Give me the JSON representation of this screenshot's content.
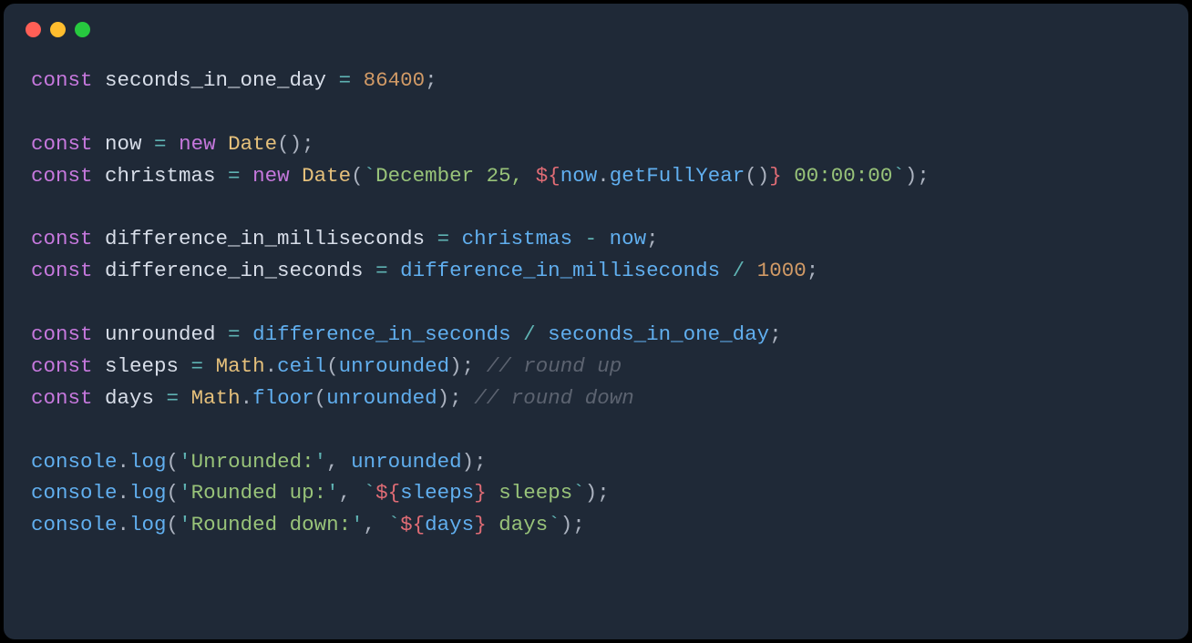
{
  "titlebar": {
    "close_color": "#ff5f56",
    "minimize_color": "#ffbd2e",
    "maximize_color": "#27c93f"
  },
  "code": {
    "l01": {
      "kw1": "const",
      "var": " seconds_in_one_day ",
      "eq": "=",
      "sp": " ",
      "num": "86400",
      "semi": ";"
    },
    "l03": {
      "kw1": "const",
      "var": " now ",
      "eq": "=",
      "sp": " ",
      "kw2": "new",
      "sp2": " ",
      "cls": "Date",
      "paren": "();"
    },
    "l04": {
      "kw1": "const",
      "var": " christmas ",
      "eq": "=",
      "sp": " ",
      "kw2": "new",
      "sp2": " ",
      "cls": "Date",
      "open": "(",
      "bt1": "`",
      "str1": "December 25, ",
      "tpl_open": "${",
      "ref": "now",
      "dot": ".",
      "fn": "getFullYear",
      "pn": "()",
      "tpl_close": "}",
      "str2": " 00:00:00",
      "bt2": "`",
      "close": ");"
    },
    "l06": {
      "kw1": "const",
      "var": " difference_in_milliseconds ",
      "eq": "=",
      "sp": " ",
      "a": "christmas",
      "op": " - ",
      "b": "now",
      "semi": ";"
    },
    "l07": {
      "kw1": "const",
      "var": " difference_in_seconds ",
      "eq": "=",
      "sp": " ",
      "a": "difference_in_milliseconds",
      "op": " / ",
      "num": "1000",
      "semi": ";"
    },
    "l09": {
      "kw1": "const",
      "var": " unrounded ",
      "eq": "=",
      "sp": " ",
      "a": "difference_in_seconds",
      "op": " / ",
      "b": "seconds_in_one_day",
      "semi": ";"
    },
    "l10": {
      "kw1": "const",
      "var": " sleeps ",
      "eq": "=",
      "sp": " ",
      "obj": "Math",
      "dot": ".",
      "fn": "ceil",
      "open": "(",
      "arg": "unrounded",
      "close": ");",
      "sp2": " ",
      "cmt": "// round up"
    },
    "l11": {
      "kw1": "const",
      "var": " days ",
      "eq": "=",
      "sp": " ",
      "obj": "Math",
      "dot": ".",
      "fn": "floor",
      "open": "(",
      "arg": "unrounded",
      "close": ");",
      "sp2": " ",
      "cmt": "// round down"
    },
    "l13": {
      "obj": "console",
      "dot": ".",
      "fn": "log",
      "open": "(",
      "q1": "'",
      "str": "Unrounded:",
      "q2": "'",
      "comma": ", ",
      "arg": "unrounded",
      "close": ");"
    },
    "l14": {
      "obj": "console",
      "dot": ".",
      "fn": "log",
      "open": "(",
      "q1": "'",
      "str": "Rounded up:",
      "q2": "'",
      "comma": ", ",
      "bt1": "`",
      "tpl_open": "${",
      "ref": "sleeps",
      "tpl_close": "}",
      "str2": " sleeps",
      "bt2": "`",
      "close": ");"
    },
    "l15": {
      "obj": "console",
      "dot": ".",
      "fn": "log",
      "open": "(",
      "q1": "'",
      "str": "Rounded down:",
      "q2": "'",
      "comma": ", ",
      "bt1": "`",
      "tpl_open": "${",
      "ref": "days",
      "tpl_close": "}",
      "str2": " days",
      "bt2": "`",
      "close": ");"
    }
  }
}
